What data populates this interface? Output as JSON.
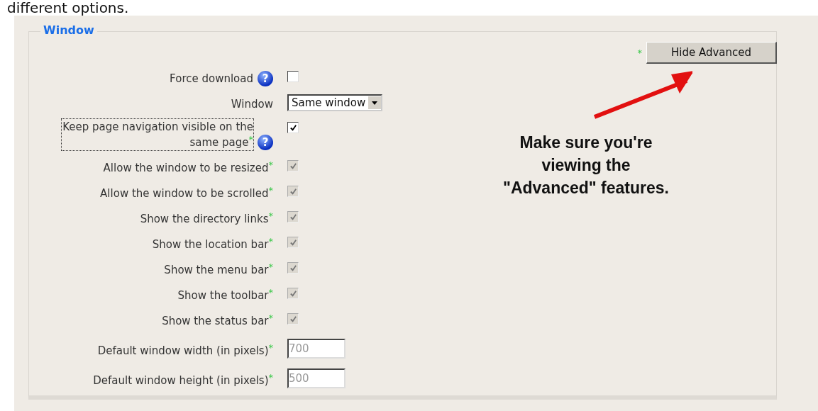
{
  "intro_text": "different options.",
  "fieldset": {
    "legend": "Window",
    "advanced_button": {
      "label": "Hide Advanced",
      "required_mark": "*"
    },
    "rows": [
      {
        "kind": "checkbox",
        "label": "Force download",
        "help": "?",
        "checked": false,
        "disabled": false,
        "focused": false
      },
      {
        "kind": "select",
        "label": "Window",
        "value": "Same window"
      },
      {
        "kind": "checkbox",
        "label": "Keep page navigation visible on the same page",
        "required_mark": "*",
        "help": "?",
        "checked": true,
        "disabled": false,
        "focused": true
      },
      {
        "kind": "checkbox",
        "label": "Allow the window to be resized",
        "required_mark": "*",
        "checked": true,
        "disabled": true,
        "focused": false
      },
      {
        "kind": "checkbox",
        "label": "Allow the window to be scrolled",
        "required_mark": "*",
        "checked": true,
        "disabled": true,
        "focused": false
      },
      {
        "kind": "checkbox",
        "label": "Show the directory links",
        "required_mark": "*",
        "checked": true,
        "disabled": true,
        "focused": false
      },
      {
        "kind": "checkbox",
        "label": "Show the location bar",
        "required_mark": "*",
        "checked": true,
        "disabled": true,
        "focused": false
      },
      {
        "kind": "checkbox",
        "label": "Show the menu bar",
        "required_mark": "*",
        "checked": true,
        "disabled": true,
        "focused": false
      },
      {
        "kind": "checkbox",
        "label": "Show the toolbar",
        "required_mark": "*",
        "checked": true,
        "disabled": true,
        "focused": false
      },
      {
        "kind": "checkbox",
        "label": "Show the status bar",
        "required_mark": "*",
        "checked": true,
        "disabled": true,
        "focused": false
      },
      {
        "kind": "text",
        "label": "Default window width (in pixels)",
        "required_mark": "*",
        "value": "700",
        "disabled": true
      },
      {
        "kind": "text",
        "label": "Default window height (in pixels)",
        "required_mark": "*",
        "value": "500",
        "disabled": true
      }
    ]
  },
  "annotation": {
    "text": "Make sure you're viewing the \"Advanced\" features."
  }
}
